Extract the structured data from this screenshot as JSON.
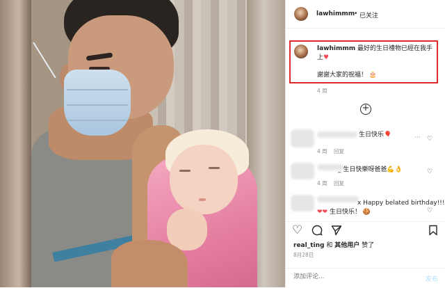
{
  "header": {
    "username": "lawhimmm",
    "dot": "•",
    "follow_status": "已关注"
  },
  "caption": {
    "username": "lawhimmm",
    "text_line1": "最好的生日禮物已經在我手上",
    "heart": "♥",
    "text_line2": "謝謝大家的祝福！",
    "cake": "🎂",
    "time": "4 周"
  },
  "comments": [
    {
      "text": "生日快乐",
      "emoji": "🎈",
      "time": "4 周",
      "reply": "回复"
    },
    {
      "text": "_ 生日快樂呀爸爸",
      "emoji": "💪👌",
      "time": "4 周",
      "reply": "回复"
    },
    {
      "text": "x Happy belated birthday!!!",
      "emoji": "❤❤",
      "text2": "生日快乐！",
      "emoji2": "🍪",
      "time": "",
      "reply": ""
    }
  ],
  "likes": {
    "prefix": "real_ting",
    "mid": "和",
    "others": "其他用户",
    "suffix": "赞了"
  },
  "date": "8月28日",
  "add_comment": {
    "placeholder": "添加评论...",
    "post_label": "发布"
  },
  "colors": {
    "highlight_border": "#e0282c",
    "heart_red": "#ed4956",
    "muted": "#8e8e8e"
  },
  "icons": [
    "more-icon",
    "add-circle-icon",
    "heart-icon",
    "comment-icon",
    "share-icon",
    "bookmark-icon"
  ]
}
